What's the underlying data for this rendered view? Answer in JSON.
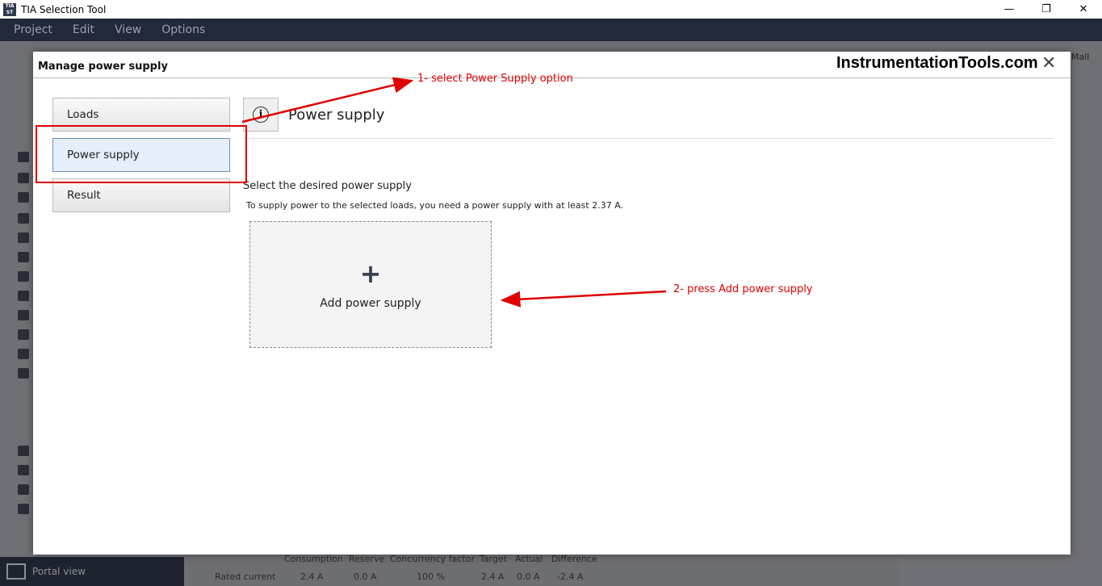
{
  "window": {
    "title": "TIA Selection Tool",
    "minimize": "—",
    "restore": "❐",
    "close": "✕"
  },
  "menu": [
    "Project",
    "Edit",
    "View",
    "Options"
  ],
  "background": {
    "mall": "Mall",
    "portal_view": "Portal view",
    "table": {
      "headers": [
        "Consumption",
        "Reserve",
        "Concurrency factor",
        "Target",
        "Actual",
        "Difference"
      ],
      "row_label": "Rated current",
      "values": [
        "2.4 A",
        "0.0 A",
        "100 %",
        "2.4 A",
        "0.0 A",
        "-2.4 A"
      ]
    }
  },
  "dialog": {
    "title": "Manage power supply",
    "watermark": "InstrumentationTools.com",
    "close": "✕",
    "nav": [
      "Loads",
      "Power supply",
      "Result"
    ],
    "page_title": "Power supply",
    "select_label": "Select the desired power supply",
    "hint": "To supply power to the selected loads, you need a power supply with at least 2.37 A.",
    "add_plus": "+",
    "add_label": "Add power supply"
  },
  "annotations": {
    "step1": "1- select Power Supply option",
    "step2": "2- press Add power supply",
    "color": "#e00000"
  }
}
